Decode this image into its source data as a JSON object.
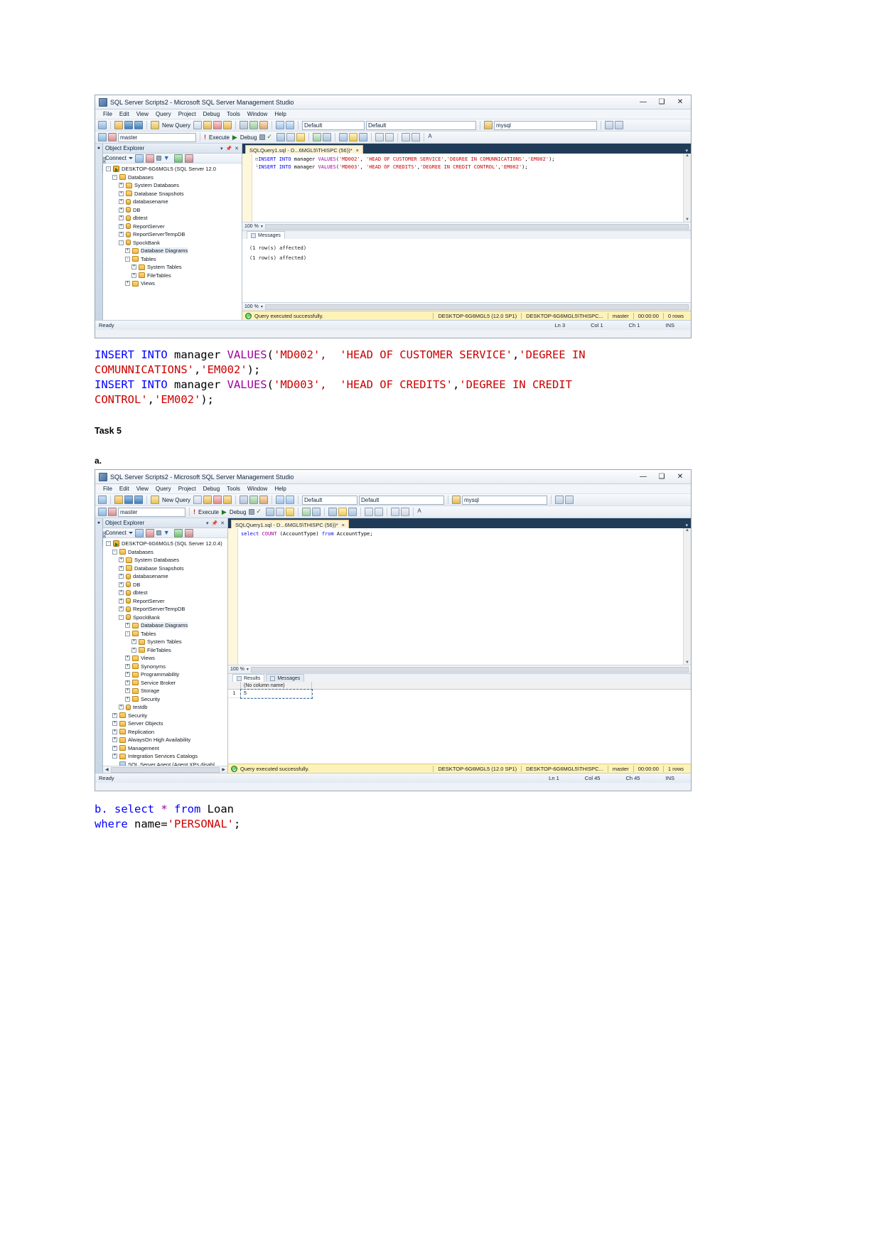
{
  "window1": {
    "title": "SQL Server Scripts2 - Microsoft SQL Server Management Studio",
    "window_buttons": {
      "minimize": "—",
      "maximize": "❑",
      "close": "✕"
    },
    "menus": [
      "File",
      "Edit",
      "View",
      "Query",
      "Project",
      "Debug",
      "Tools",
      "Window",
      "Help"
    ],
    "toolbar": {
      "new_query": "New Query",
      "execute": "Execute",
      "debug": "Debug",
      "combo1": "Default",
      "combo2": "Default",
      "combo3": "mysql",
      "db_combo": "master"
    },
    "object_explorer": {
      "title": "Object Explorer",
      "connect_label": "Connect",
      "nodes": [
        {
          "label": "DESKTOP-6G6MGL5 (SQL Server 12.0",
          "depth": 0,
          "exp": "-",
          "icon": "server-icon"
        },
        {
          "label": "Databases",
          "depth": 1,
          "exp": "-",
          "icon": "folder-icon"
        },
        {
          "label": "System Databases",
          "depth": 2,
          "exp": "+",
          "icon": "folder-icon"
        },
        {
          "label": "Database Snapshots",
          "depth": 2,
          "exp": "+",
          "icon": "folder-icon"
        },
        {
          "label": "databasename",
          "depth": 2,
          "exp": "+",
          "icon": "database-icon"
        },
        {
          "label": "DB",
          "depth": 2,
          "exp": "+",
          "icon": "database-icon"
        },
        {
          "label": "dbtest",
          "depth": 2,
          "exp": "+",
          "icon": "database-icon"
        },
        {
          "label": "ReportServer",
          "depth": 2,
          "exp": "+",
          "icon": "database-icon"
        },
        {
          "label": "ReportServerTempDB",
          "depth": 2,
          "exp": "+",
          "icon": "database-icon"
        },
        {
          "label": "SpockBank",
          "depth": 2,
          "exp": "-",
          "icon": "database-icon"
        },
        {
          "label": "Database Diagrams",
          "depth": 3,
          "exp": "+",
          "icon": "folder-icon"
        },
        {
          "label": "Tables",
          "depth": 3,
          "exp": "-",
          "icon": "folder-icon"
        },
        {
          "label": "System Tables",
          "depth": 4,
          "exp": "+",
          "icon": "folder-icon"
        },
        {
          "label": "FileTables",
          "depth": 4,
          "exp": "+",
          "icon": "folder-icon"
        },
        {
          "label": "Views",
          "depth": 3,
          "exp": "+",
          "icon": "folder-icon"
        }
      ]
    },
    "editor": {
      "tab_label": "SQLQuery1.sql - D...6MGL5\\THISPC (56))*",
      "tab_close": "×",
      "lines": [
        [
          {
            "t": "INSERT INTO ",
            "c": "kw"
          },
          {
            "t": "manager ",
            "c": "pl"
          },
          {
            "t": "VALUES",
            "c": "kw2"
          },
          {
            "t": "(",
            "c": "pl"
          },
          {
            "t": "'MD002'",
            "c": "str"
          },
          {
            "t": ",  ",
            "c": "pl"
          },
          {
            "t": "'HEAD OF CUSTOMER SERVICE'",
            "c": "str"
          },
          {
            "t": ",",
            "c": "pl"
          },
          {
            "t": "'DEGREE IN COMUNNICATIONS'",
            "c": "str"
          },
          {
            "t": ",",
            "c": "pl"
          },
          {
            "t": "'EM002'",
            "c": "str"
          },
          {
            "t": ");",
            "c": "pl"
          }
        ],
        [
          {
            "t": "INSERT INTO ",
            "c": "kw"
          },
          {
            "t": "manager ",
            "c": "pl"
          },
          {
            "t": "VALUES",
            "c": "kw2"
          },
          {
            "t": "(",
            "c": "pl"
          },
          {
            "t": "'MD003'",
            "c": "str"
          },
          {
            "t": ",  ",
            "c": "pl"
          },
          {
            "t": "'HEAD OF CREDITS'",
            "c": "str"
          },
          {
            "t": ",",
            "c": "pl"
          },
          {
            "t": "'DEGREE IN CREDIT CONTROL'",
            "c": "str"
          },
          {
            "t": ",",
            "c": "pl"
          },
          {
            "t": "'EM002'",
            "c": "str"
          },
          {
            "t": ");",
            "c": "pl"
          }
        ]
      ],
      "zoom_top": "100 %",
      "zoom_bottom": "100 %"
    },
    "results": {
      "messages_tab": "Messages",
      "messages": [
        "(1 row(s) affected)",
        "(1 row(s) affected)"
      ]
    },
    "status": {
      "query_status": "Query executed successfully.",
      "server": "DESKTOP-6G6MGL5 (12.0 SP1)",
      "user": "DESKTOP-6G6MGL5\\THISPC...",
      "database": "master",
      "time": "00:00:00",
      "rows": "0 rows"
    },
    "bottom_status": {
      "ready": "Ready",
      "ln": "Ln 3",
      "col": "Col 1",
      "ch": "Ch 1",
      "ins": "INS"
    }
  },
  "code_block_1": {
    "lines": [
      [
        {
          "t": "INSERT INTO ",
          "c": "kw"
        },
        {
          "t": "manager ",
          "c": "pl"
        },
        {
          "t": "VALUES",
          "c": "kw2"
        },
        {
          "t": "(",
          "c": "pl"
        },
        {
          "t": "'MD002',  'HEAD OF CUSTOMER SERVICE'",
          "c": "str"
        },
        {
          "t": ",",
          "c": "pl"
        },
        {
          "t": "'DEGREE IN",
          "c": "str"
        }
      ],
      [
        {
          "t": "COMUNNICATIONS'",
          "c": "str"
        },
        {
          "t": ",",
          "c": "pl"
        },
        {
          "t": "'EM002'",
          "c": "str"
        },
        {
          "t": ");",
          "c": "pl"
        }
      ],
      [
        {
          "t": "INSERT INTO ",
          "c": "kw"
        },
        {
          "t": "manager ",
          "c": "pl"
        },
        {
          "t": "VALUES",
          "c": "kw2"
        },
        {
          "t": "(",
          "c": "pl"
        },
        {
          "t": "'MD003',  'HEAD OF CREDITS'",
          "c": "str"
        },
        {
          "t": ",",
          "c": "pl"
        },
        {
          "t": "'DEGREE IN CREDIT",
          "c": "str"
        }
      ],
      [
        {
          "t": "CONTROL'",
          "c": "str"
        },
        {
          "t": ",",
          "c": "pl"
        },
        {
          "t": "'EM002'",
          "c": "str"
        },
        {
          "t": ");",
          "c": "pl"
        }
      ]
    ]
  },
  "task5_heading": "Task 5",
  "label_a": "a.",
  "window2": {
    "title": "SQL Server Scripts2 - Microsoft SQL Server Management Studio",
    "window_buttons": {
      "minimize": "—",
      "maximize": "❑",
      "close": "✕"
    },
    "menus": [
      "File",
      "Edit",
      "View",
      "Query",
      "Project",
      "Debug",
      "Tools",
      "Window",
      "Help"
    ],
    "toolbar": {
      "new_query": "New Query",
      "execute": "Execute",
      "debug": "Debug",
      "combo1": "Default",
      "combo2": "Default",
      "combo3": "mysql",
      "db_combo": "master"
    },
    "object_explorer": {
      "title": "Object Explorer",
      "connect_label": "Connect",
      "nodes": [
        {
          "label": "DESKTOP-6G6MGL5 (SQL Server 12.0.4)",
          "depth": 0,
          "exp": "-",
          "icon": "server-icon"
        },
        {
          "label": "Databases",
          "depth": 1,
          "exp": "-",
          "icon": "folder-icon"
        },
        {
          "label": "System Databases",
          "depth": 2,
          "exp": "+",
          "icon": "folder-icon"
        },
        {
          "label": "Database Snapshots",
          "depth": 2,
          "exp": "+",
          "icon": "folder-icon"
        },
        {
          "label": "databasename",
          "depth": 2,
          "exp": "+",
          "icon": "database-icon"
        },
        {
          "label": "DB",
          "depth": 2,
          "exp": "+",
          "icon": "database-icon"
        },
        {
          "label": "dbtest",
          "depth": 2,
          "exp": "+",
          "icon": "database-icon"
        },
        {
          "label": "ReportServer",
          "depth": 2,
          "exp": "+",
          "icon": "database-icon"
        },
        {
          "label": "ReportServerTempDB",
          "depth": 2,
          "exp": "+",
          "icon": "database-icon"
        },
        {
          "label": "SpockBank",
          "depth": 2,
          "exp": "-",
          "icon": "database-icon"
        },
        {
          "label": "Database Diagrams",
          "depth": 3,
          "exp": "+",
          "icon": "folder-icon"
        },
        {
          "label": "Tables",
          "depth": 3,
          "exp": "-",
          "icon": "folder-icon"
        },
        {
          "label": "System Tables",
          "depth": 4,
          "exp": "+",
          "icon": "folder-icon"
        },
        {
          "label": "FileTables",
          "depth": 4,
          "exp": "+",
          "icon": "folder-icon"
        },
        {
          "label": "Views",
          "depth": 3,
          "exp": "+",
          "icon": "folder-icon"
        },
        {
          "label": "Synonyms",
          "depth": 3,
          "exp": "+",
          "icon": "folder-icon"
        },
        {
          "label": "Programmability",
          "depth": 3,
          "exp": "+",
          "icon": "folder-icon"
        },
        {
          "label": "Service Broker",
          "depth": 3,
          "exp": "+",
          "icon": "folder-icon"
        },
        {
          "label": "Storage",
          "depth": 3,
          "exp": "+",
          "icon": "folder-icon"
        },
        {
          "label": "Security",
          "depth": 3,
          "exp": "+",
          "icon": "folder-icon"
        },
        {
          "label": "testdb",
          "depth": 2,
          "exp": "+",
          "icon": "database-icon"
        },
        {
          "label": "Security",
          "depth": 1,
          "exp": "+",
          "icon": "folder-icon"
        },
        {
          "label": "Server Objects",
          "depth": 1,
          "exp": "+",
          "icon": "folder-icon"
        },
        {
          "label": "Replication",
          "depth": 1,
          "exp": "+",
          "icon": "folder-icon"
        },
        {
          "label": "AlwaysOn High Availability",
          "depth": 1,
          "exp": "+",
          "icon": "folder-icon"
        },
        {
          "label": "Management",
          "depth": 1,
          "exp": "+",
          "icon": "folder-icon"
        },
        {
          "label": "Integration Services Catalogs",
          "depth": 1,
          "exp": "+",
          "icon": "folder-icon"
        },
        {
          "label": "SQL Server Agent (Agent XPs disabl",
          "depth": 1,
          "exp": "",
          "icon": "agent-icon"
        }
      ]
    },
    "editor": {
      "tab_label": "SQLQuery1.sql - D...6MGL5\\THISPC (56))*",
      "tab_close": "×",
      "lines": [
        [
          {
            "t": "select ",
            "c": "kw"
          },
          {
            "t": "COUNT",
            "c": "kw2"
          },
          {
            "t": " (AccountType) ",
            "c": "pl"
          },
          {
            "t": "from ",
            "c": "kw"
          },
          {
            "t": "AccountType;",
            "c": "pl"
          }
        ]
      ],
      "zoom_top": "100 %"
    },
    "results": {
      "results_tab": "Results",
      "messages_tab": "Messages",
      "columns": [
        "(No column name)"
      ],
      "rows": [
        {
          "num": "1",
          "values": [
            "5"
          ]
        }
      ]
    },
    "status": {
      "query_status": "Query executed successfully.",
      "server": "DESKTOP-6G6MGL5 (12.0 SP1)",
      "user": "DESKTOP-6G6MGL5\\THISPC...",
      "database": "master",
      "time": "00:00:00",
      "rows": "1 rows"
    },
    "bottom_status": {
      "ready": "Ready",
      "ln": "Ln 1",
      "col": "Col 45",
      "ch": "Ch 45",
      "ins": "INS"
    }
  },
  "code_block_2": {
    "lines": [
      [
        {
          "t": "b. ",
          "c": "kw"
        },
        {
          "t": "select ",
          "c": "kw"
        },
        {
          "t": "* ",
          "c": "kw2"
        },
        {
          "t": "from ",
          "c": "kw"
        },
        {
          "t": "Loan",
          "c": "pl"
        }
      ],
      [
        {
          "t": "where ",
          "c": "kw"
        },
        {
          "t": "name=",
          "c": "pl"
        },
        {
          "t": "'PERSONAL'",
          "c": "str"
        },
        {
          "t": ";",
          "c": "pl"
        }
      ]
    ]
  }
}
